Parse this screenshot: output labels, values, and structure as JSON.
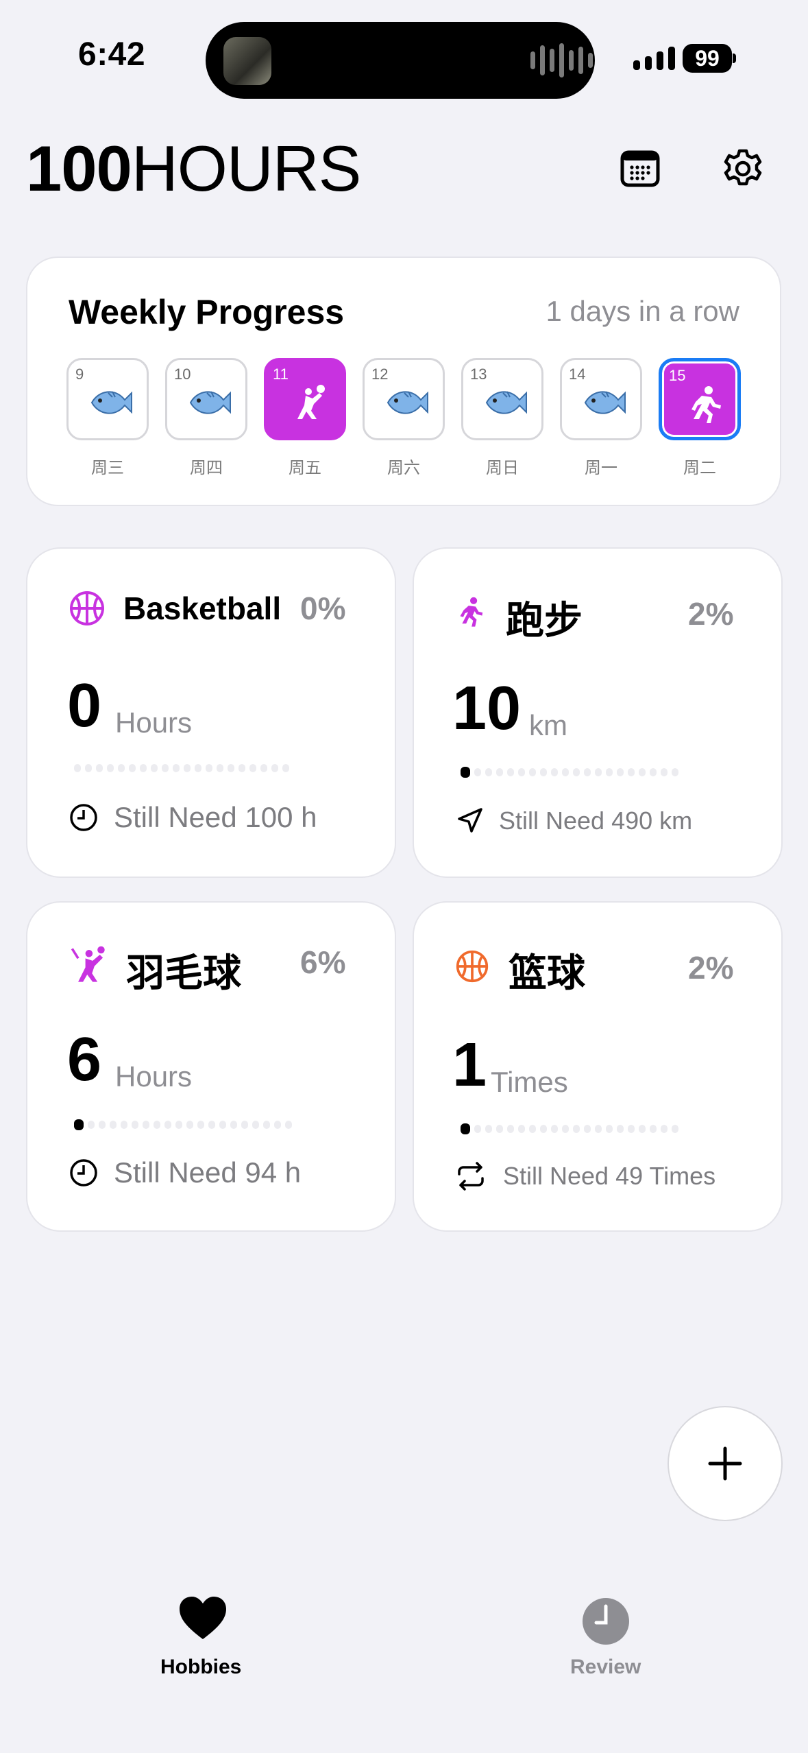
{
  "status_bar": {
    "time": "6:42",
    "battery": "99"
  },
  "header": {
    "title_number": "100",
    "title_word": "HOURS",
    "calendar_icon": "calendar-icon",
    "settings_icon": "gear-icon"
  },
  "weekly": {
    "title": "Weekly Progress",
    "streak": "1 days in a row",
    "days": [
      {
        "num": "9",
        "weekday": "周三",
        "icon": "fish-icon"
      },
      {
        "num": "10",
        "weekday": "周四",
        "icon": "fish-icon"
      },
      {
        "num": "11",
        "weekday": "周五",
        "icon": "volleyball-player-icon"
      },
      {
        "num": "12",
        "weekday": "周六",
        "icon": "fish-icon"
      },
      {
        "num": "13",
        "weekday": "周日",
        "icon": "fish-icon"
      },
      {
        "num": "14",
        "weekday": "周一",
        "icon": "fish-icon"
      },
      {
        "num": "15",
        "weekday": "周二",
        "icon": "runner-icon"
      }
    ]
  },
  "hobbies": [
    {
      "name": "Basketball",
      "percent": "0%",
      "value": "0",
      "unit": "Hours",
      "need": "Still Need 100 h",
      "progress": 0.0,
      "icon": "basketball-icon",
      "need_icon": "clock-icon",
      "color": "#c832e0"
    },
    {
      "name": "跑步",
      "percent": "2%",
      "value": "10",
      "unit": "km",
      "need": "Still Need 490 km",
      "progress": 0.02,
      "icon": "runner-icon",
      "need_icon": "location-arrow-icon",
      "color": "#c832e0"
    },
    {
      "name": "羽毛球",
      "percent": "6%",
      "value": "6",
      "unit": "Hours",
      "need": "Still Need 94 h",
      "progress": 0.06,
      "icon": "badminton-player-icon",
      "need_icon": "clock-icon",
      "color": "#c832e0"
    },
    {
      "name": "篮球",
      "percent": "2%",
      "value": "1",
      "unit": "Times",
      "need": "Still Need 49 Times",
      "progress": 0.02,
      "icon": "basketball-icon",
      "need_icon": "repeat-icon",
      "color": "#f06a2c"
    }
  ],
  "fab": {
    "icon": "plus-icon"
  },
  "tab_bar": {
    "hobbies": "Hobbies",
    "review": "Review"
  },
  "colors": {
    "accent": "#c832e0",
    "today_border": "#1a7cf5",
    "orange": "#f06a2c",
    "secondary_text": "#8e8e93"
  }
}
